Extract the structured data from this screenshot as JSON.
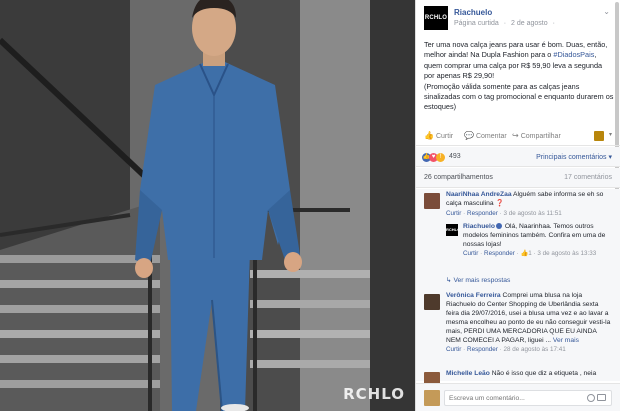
{
  "photo": {
    "watermark": "RCHLO"
  },
  "post": {
    "page_name": "Riachuelo",
    "page_logo_text": "RCHLO",
    "meta_source": "Página curtida",
    "meta_dot": "·",
    "meta_date": "2 de agosto",
    "meta_globe": "·",
    "text_part1": "Ter uma nova calça jeans para usar é bom. Duas, então, melhor ainda! Na Dupla Fashion para o ",
    "hashtag": "#DiadosPais",
    "text_part2": ", quem comprar uma calça por R$ 59,90 leva a segunda por apenas R$ 29,90!",
    "text_part3": "(Promoção válida somente para as calças jeans sinalizadas com o tag promocional e enquanto durarem os estoques)"
  },
  "actions": {
    "like": "Curtir",
    "comment": "Comentar",
    "share": "Compartilhar"
  },
  "reactions": {
    "count": "493",
    "sort_label": "Principais comentários ▾"
  },
  "stats": {
    "shares": "26 compartilhamentos",
    "comments": "17 comentários"
  },
  "comments": [
    {
      "name": "NaariNhaa AndreZaa",
      "text": "Alguém sabe informa se eh so calça masculina",
      "emoji": "❓",
      "reply_label": "Curtir",
      "reply_sep": " · ",
      "reply_action": "Responder",
      "time": "3 de agosto às 11:51"
    },
    {
      "name": "Verônica Ferreira",
      "text": "Comprei uma blusa na loja Riachuelo do Center Shopping de Uberlândia sexta feira dia 29/07/2016, usei a blusa uma vez e ao lavar a mesma encolheu ao ponto de eu não conseguir vesti-la mais, PERDI UMA MERCADORIA QUE EU AINDA NEM COMECEI A PAGAR, liguei ...",
      "more": "Ver mais",
      "reply_label": "Curtir",
      "reply_action": "Responder",
      "time": "28 de agosto às 17:41"
    },
    {
      "name": "Michelle Leão",
      "text": "Não é isso que diz a etiqueta , neia"
    }
  ],
  "reply": {
    "name": "Riachuelo",
    "text": "Olá, Naarinhaa. Temos outros modelos femininos também. Confira em uma de nossas lojas!",
    "reply_label": "Curtir",
    "reply_action": "Responder",
    "likes": "1",
    "time": "3 de agosto às 13:33"
  },
  "more_replies": "↳ Ver mais respostas",
  "write_placeholder": "Escreva um comentário...",
  "colors": {
    "link": "#365899",
    "like_blue": "#4267b2",
    "love_red": "#f25268",
    "wow_yellow": "#f7b125"
  }
}
